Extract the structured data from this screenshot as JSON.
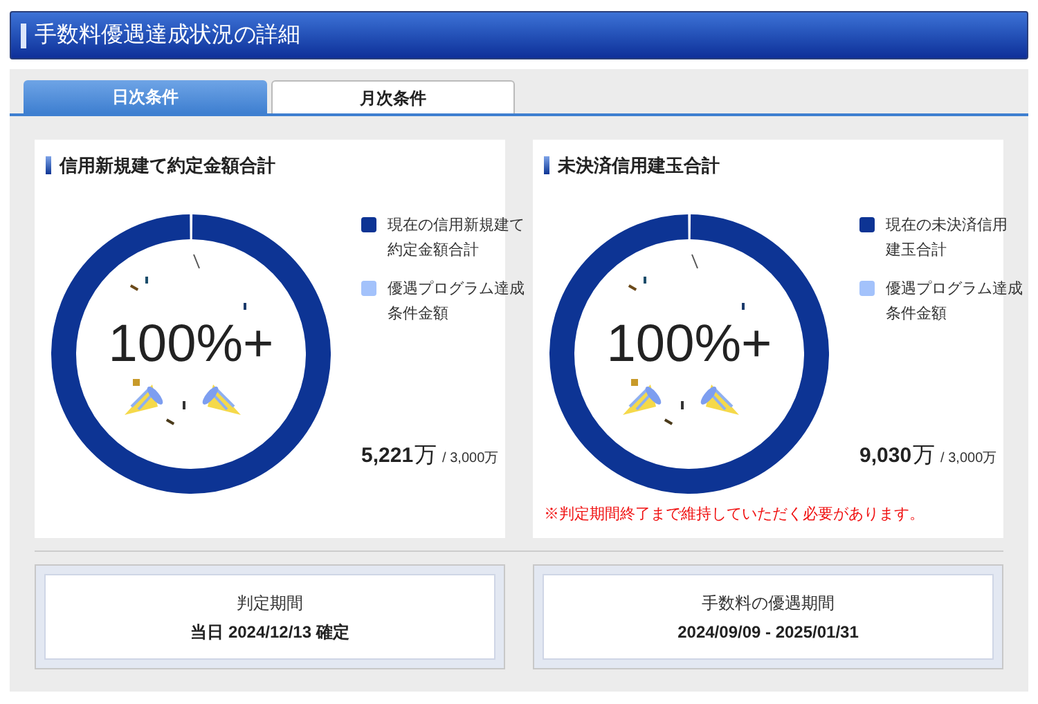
{
  "header": {
    "title": "手数料優遇達成状況の詳細"
  },
  "tabs": [
    {
      "label": "日次条件",
      "selected": true
    },
    {
      "label": "月次条件",
      "selected": false
    }
  ],
  "panels": [
    {
      "title": "信用新規建て約定金額合計",
      "level": 1,
      "percent_label": "100%+",
      "legend": [
        {
          "lines": [
            "現在の信用新規建て",
            "約定金額合計"
          ],
          "color": "#0d3494"
        },
        {
          "lines": [
            "優遇プログラム達成",
            "条件金額"
          ],
          "color": "#a3c2fb"
        }
      ],
      "amount": "5,221",
      "amount_unit": "万",
      "target": "/ 3,000万"
    },
    {
      "title": "未決済信用建玉合計",
      "level": 1,
      "percent_label": "100%+",
      "legend": [
        {
          "lines": [
            "現在の未決済信用",
            "建玉合計"
          ],
          "color": "#0d3494"
        },
        {
          "lines": [
            "優遇プログラム達成",
            "条件金額"
          ],
          "color": "#a3c2fb"
        }
      ],
      "amount": "9,030",
      "amount_unit": "万",
      "target": "/ 3,000万",
      "note": "※判定期間終了まで維持していただく必要があります。"
    }
  ],
  "periods": [
    {
      "label": "判定期間",
      "value": "当日 2024/12/13 確定"
    },
    {
      "label": "手数料の優遇期間",
      "value": "2024/09/09 - 2025/01/31"
    }
  ]
}
